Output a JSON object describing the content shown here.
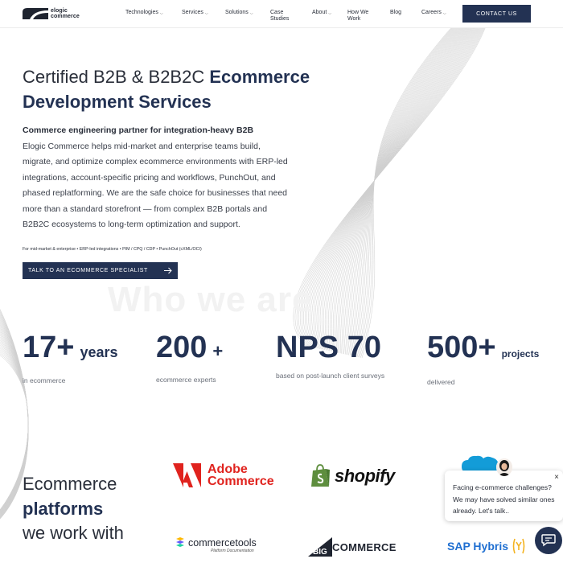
{
  "header": {
    "logo_line1": "elogic",
    "logo_line2": "commerce",
    "nav": [
      {
        "label": "Technologies",
        "has_dropdown": true
      },
      {
        "label": "Services",
        "has_dropdown": true
      },
      {
        "label": "Solutions",
        "has_dropdown": true
      },
      {
        "label_line1": "Case",
        "label_line2": "Studies",
        "has_dropdown": false
      },
      {
        "label": "About",
        "has_dropdown": true
      },
      {
        "label_line1": "How We",
        "label_line2": "Work",
        "has_dropdown": false
      },
      {
        "label": "Blog",
        "has_dropdown": false
      },
      {
        "label": "Careers",
        "has_dropdown": true
      }
    ],
    "contact_label": "CONTACT US"
  },
  "hero": {
    "title_plain": "Certified B2B & B2B2C ",
    "title_strong": "Ecommerce Development Services",
    "subtitle": "Commerce engineering partner for integration-heavy B2B",
    "body": "Elogic Commerce helps mid-market and enterprise teams build, migrate, and optimize complex ecommerce environments with ERP-led integrations, account-specific pricing and workflows, PunchOut, and phased replatforming. We are the safe choice for businesses that need more than a standard storefront — from complex B2B portals and B2B2C ecosystems to long-term optimization and support.",
    "tags": "For mid-market & enterprise • ERP-led integrations • PIM / CPQ / CDP • PunchOut (cXML/OCI)",
    "cta_label": "TALK TO AN ECOMMERCE SPECIALIST",
    "ghost_heading": "Who we are"
  },
  "stats": [
    {
      "value": "17+",
      "unit": "years",
      "label": "in ecommerce"
    },
    {
      "value": "200",
      "unit": "+",
      "label": "ecommerce experts"
    },
    {
      "value": "NPS 70",
      "unit": "",
      "label": "based on post-launch client surveys"
    },
    {
      "value": "500+",
      "unit": "projects",
      "label": "delivered"
    }
  ],
  "platforms": {
    "title_line1": "Ecommerce",
    "title_line2": "platforms",
    "title_line3": "we work with",
    "adobe_line1": "Adobe",
    "adobe_line2": "Commerce",
    "shopify": "shopify",
    "commercetools": "commercetools",
    "commercetools_sub": "Platform Documentation",
    "bigcommerce_prefix": "BIG",
    "bigcommerce_suffix": "COMMERCE",
    "sap": "SAP Hybris"
  },
  "chat": {
    "message": "Facing e-commerce challenges? We may have solved similar ones already. Let's talk..",
    "close": "×"
  },
  "colors": {
    "brand_navy": "#233253",
    "adobe_red": "#e0231e",
    "shopify_green": "#5e8e3e",
    "sap_blue": "#1f6fd1",
    "salesforce_blue": "#139cd8"
  }
}
